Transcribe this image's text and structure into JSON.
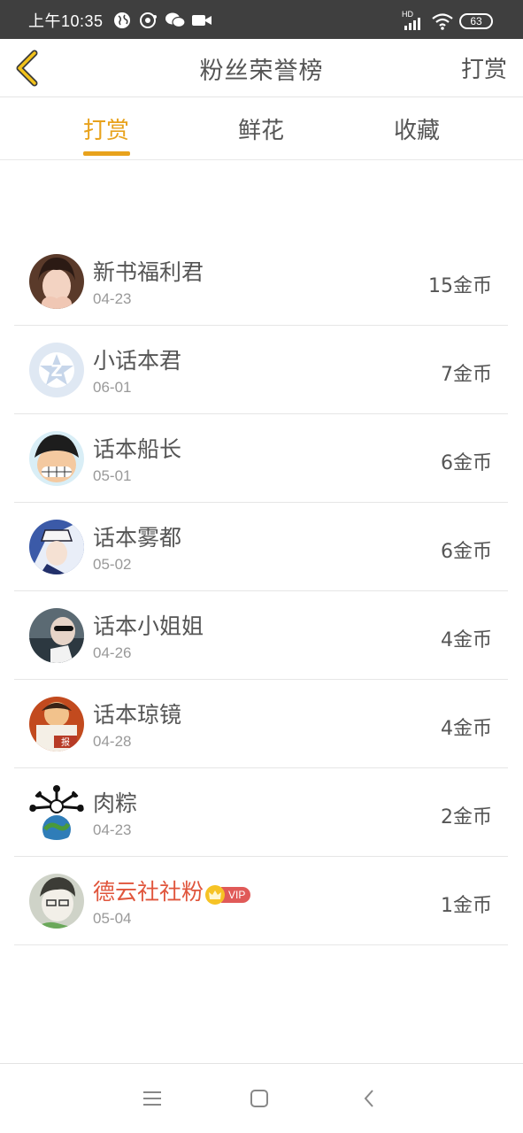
{
  "status_bar": {
    "time": "上午10:35",
    "network": "HD",
    "battery": "63",
    "icons": [
      "globe-icon",
      "music-icon",
      "wechat-icon",
      "video-icon",
      "signal-icon",
      "wifi-icon",
      "battery-icon"
    ]
  },
  "header": {
    "title": "粉丝荣誉榜",
    "action_label": "打赏",
    "back_icon": "chevron-left-icon"
  },
  "tabs": [
    {
      "label": "打赏",
      "active": true
    },
    {
      "label": "鲜花",
      "active": false
    },
    {
      "label": "收藏",
      "active": false
    }
  ],
  "colors": {
    "accent": "#e8a21c",
    "vip_name": "#e0553c",
    "status_bar": "#3f3f3f"
  },
  "fans": [
    {
      "name": "新书福利君",
      "date": "04-23",
      "amount": "15金币",
      "vip": false
    },
    {
      "name": "小话本君",
      "date": "06-01",
      "amount": "7金币",
      "vip": false
    },
    {
      "name": "话本船长",
      "date": "05-01",
      "amount": "6金币",
      "vip": false
    },
    {
      "name": "话本雾都",
      "date": "05-02",
      "amount": "6金币",
      "vip": false
    },
    {
      "name": "话本小姐姐",
      "date": "04-26",
      "amount": "4金币",
      "vip": false
    },
    {
      "name": "话本琼镜",
      "date": "04-28",
      "amount": "4金币",
      "vip": false
    },
    {
      "name": "肉粽",
      "date": "04-23",
      "amount": "2金币",
      "vip": false
    },
    {
      "name": "德云社社粉",
      "date": "05-04",
      "amount": "1金币",
      "vip": true,
      "vip_label": "VIP"
    }
  ],
  "nav": {
    "buttons": [
      "menu-icon",
      "home-icon",
      "back-icon"
    ]
  }
}
